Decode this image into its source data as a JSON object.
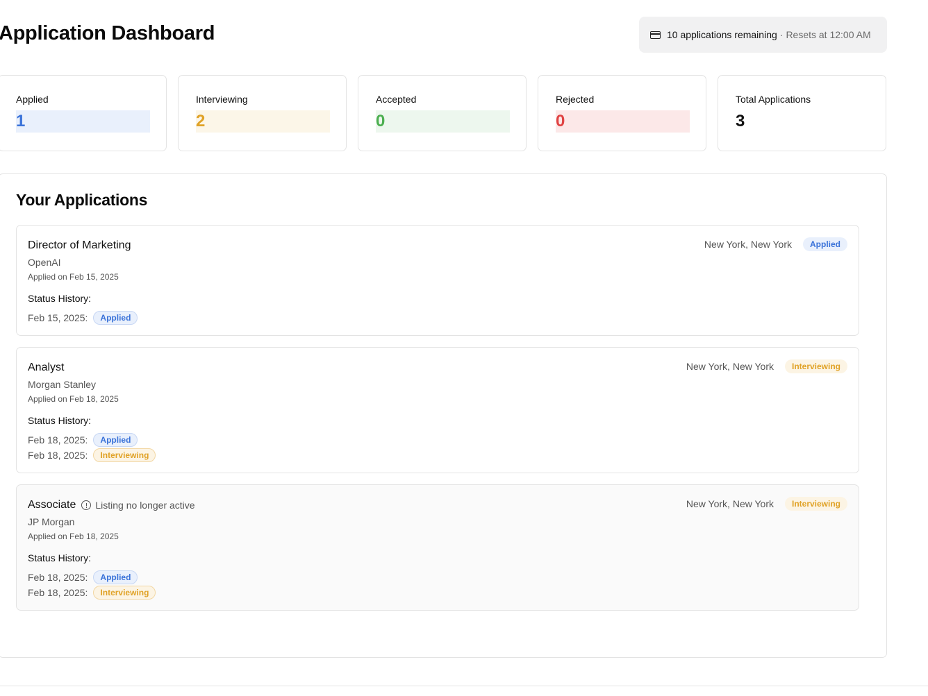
{
  "page": {
    "title": "Application Dashboard"
  },
  "quota": {
    "icon": "credit-card-icon",
    "remaining": "10 applications remaining",
    "separator": "·",
    "reset": "Resets at 12:00 AM"
  },
  "colors": {
    "applied": "#3b73d9",
    "interviewing": "#e0a227",
    "accepted": "#4caf50",
    "rejected": "#e04343"
  },
  "stats": [
    {
      "label": "Applied",
      "value": "1"
    },
    {
      "label": "Interviewing",
      "value": "2"
    },
    {
      "label": "Accepted",
      "value": "0"
    },
    {
      "label": "Rejected",
      "value": "0"
    },
    {
      "label": "Total Applications",
      "value": "3"
    }
  ],
  "applications_section": {
    "title": "Your Applications"
  },
  "applications": [
    {
      "title": "Director of Marketing",
      "company": "OpenAI",
      "applied_on": "Applied on Feb 15, 2025",
      "location": "New York, New York",
      "status": "Applied",
      "history_label": "Status History:",
      "history": [
        {
          "date": "Feb 15, 2025:",
          "status": "Applied"
        }
      ]
    },
    {
      "title": "Analyst",
      "company": "Morgan Stanley",
      "applied_on": "Applied on Feb 18, 2025",
      "location": "New York, New York",
      "status": "Interviewing",
      "history_label": "Status History:",
      "history": [
        {
          "date": "Feb 18, 2025:",
          "status": "Applied"
        },
        {
          "date": "Feb 18, 2025:",
          "status": "Interviewing"
        }
      ]
    },
    {
      "title": "Associate",
      "inactive_note": "Listing no longer active",
      "company": "JP Morgan",
      "applied_on": "Applied on Feb 18, 2025",
      "location": "New York, New York",
      "status": "Interviewing",
      "history_label": "Status History:",
      "history": [
        {
          "date": "Feb 18, 2025:",
          "status": "Applied"
        },
        {
          "date": "Feb 18, 2025:",
          "status": "Interviewing"
        }
      ]
    }
  ]
}
